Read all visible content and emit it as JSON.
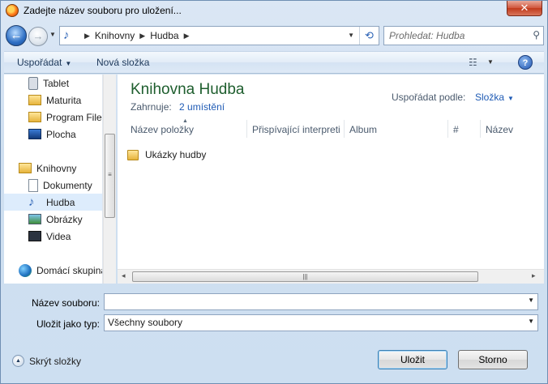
{
  "window": {
    "title": "Zadejte název souboru pro uložení...",
    "close_label": "✕"
  },
  "nav": {
    "back_icon": "back-arrow-icon",
    "forward_icon": "forward-arrow-icon",
    "address": {
      "crumbs": [
        "Knihovny",
        "Hudba"
      ]
    },
    "search_placeholder": "Prohledat: Hudba"
  },
  "toolbar": {
    "organize_label": "Uspořádat",
    "new_folder_label": "Nová složka",
    "help_label": "?"
  },
  "sidebar": {
    "items": [
      {
        "label": "Tablet",
        "icon": "tablet-icon"
      },
      {
        "label": "Maturita",
        "icon": "folder-people-icon"
      },
      {
        "label": "Program Files",
        "icon": "folder-program-icon"
      },
      {
        "label": "Plocha",
        "icon": "desktop-icon"
      },
      {
        "label": "Knihovny",
        "icon": "libraries-icon"
      },
      {
        "label": "Dokumenty",
        "icon": "documents-icon"
      },
      {
        "label": "Hudba",
        "icon": "music-icon",
        "selected": true
      },
      {
        "label": "Obrázky",
        "icon": "pictures-icon"
      },
      {
        "label": "Videa",
        "icon": "videos-icon"
      },
      {
        "label": "Domácí skupina",
        "icon": "homegroup-icon"
      }
    ]
  },
  "library": {
    "title": "Knihovna Hudba",
    "includes_label": "Zahrnuje:",
    "includes_link": "2 umístění",
    "sort_by_label": "Uspořádat podle:",
    "sort_by_value": "Složka"
  },
  "columns": [
    "Název položky",
    "Přispívající interpreti",
    "Album",
    "#",
    "Název"
  ],
  "files": [
    {
      "name": "Ukázky hudby",
      "icon": "folder-icon"
    }
  ],
  "form": {
    "filename_label": "Název souboru:",
    "filename_value": "",
    "filetype_label": "Uložit jako typ:",
    "filetype_value": "Všechny soubory"
  },
  "footer": {
    "hide_folders_label": "Skrýt složky",
    "save_label": "Uložit",
    "cancel_label": "Storno"
  },
  "colors": {
    "accent": "#1f5bb5",
    "library_title": "#1e5e2e",
    "selection": "#ddecfc"
  }
}
